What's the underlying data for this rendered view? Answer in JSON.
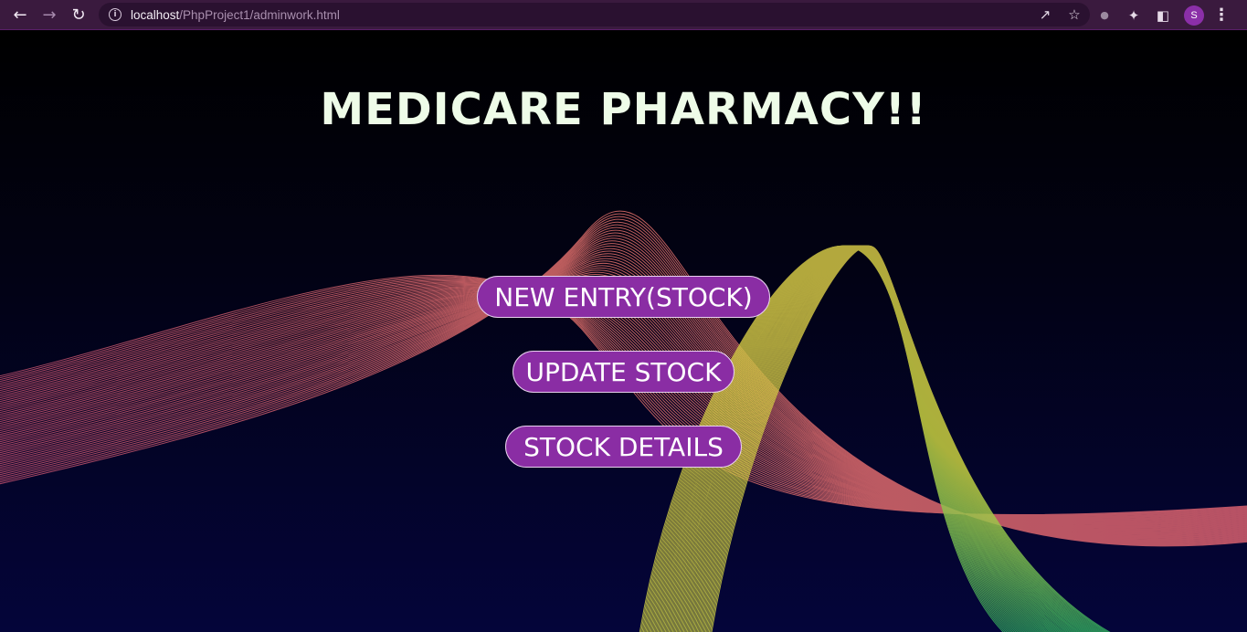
{
  "browser": {
    "url_host": "localhost",
    "url_path": "/PhpProject1/adminwork.html",
    "profile_initial": "S",
    "icons": [
      "back-icon",
      "forward-icon",
      "reload-icon",
      "info-icon",
      "share-icon",
      "star-icon",
      "extension-icon",
      "puzzle-icon",
      "sidebar-icon",
      "menu-icon"
    ]
  },
  "page": {
    "title": "MEDICARE PHARMACY!!",
    "buttons": {
      "new_entry": "NEW ENTRY(STOCK)",
      "update_stock": "UPDATE STOCK",
      "stock_details": "STOCK DETAILS"
    }
  },
  "colors": {
    "title": "#eefce8",
    "button_bg": "#8a2da4",
    "chrome_bg": "#3a1a3e"
  }
}
